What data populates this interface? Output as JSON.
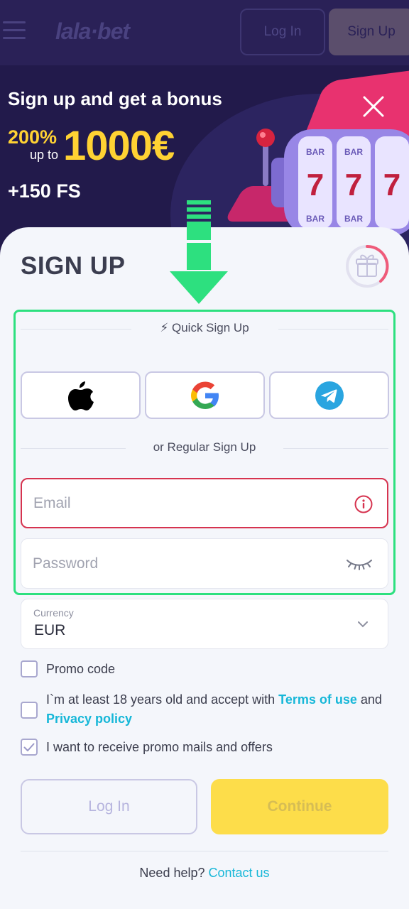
{
  "header": {
    "logo": "lala·bet",
    "login_label": "Log In",
    "signup_label": "Sign Up"
  },
  "banner": {
    "title": "Sign up and get a bonus",
    "percent": "200%",
    "up_to": "up to",
    "amount": "1000€",
    "free_spins": "+150 FS"
  },
  "form": {
    "title": "SIGN UP",
    "quick_label": "⚡ Quick Sign Up",
    "regular_label": "or Regular Sign Up",
    "social": [
      "apple-icon",
      "google-icon",
      "telegram-icon"
    ],
    "email_placeholder": "Email",
    "password_placeholder": "Password",
    "currency_label": "Currency",
    "currency_value": "EUR",
    "promo_label": "Promo code",
    "terms_prefix": "I`m at least 18 years old and accept with ",
    "terms_link": "Terms of use",
    "terms_and": " and",
    "privacy_link": "Privacy policy",
    "mails_label": "I want to receive promo mails and offers",
    "promo_checked": false,
    "terms_checked": false,
    "mails_checked": true,
    "login_button": "Log In",
    "continue_button": "Continue",
    "help_text": "Need help?",
    "contact_link": "Contact us"
  },
  "colors": {
    "accent_green": "#2de07f",
    "error_red": "#d6334f",
    "link_cyan": "#16b7d8",
    "continue_yellow": "#fddd4a"
  }
}
